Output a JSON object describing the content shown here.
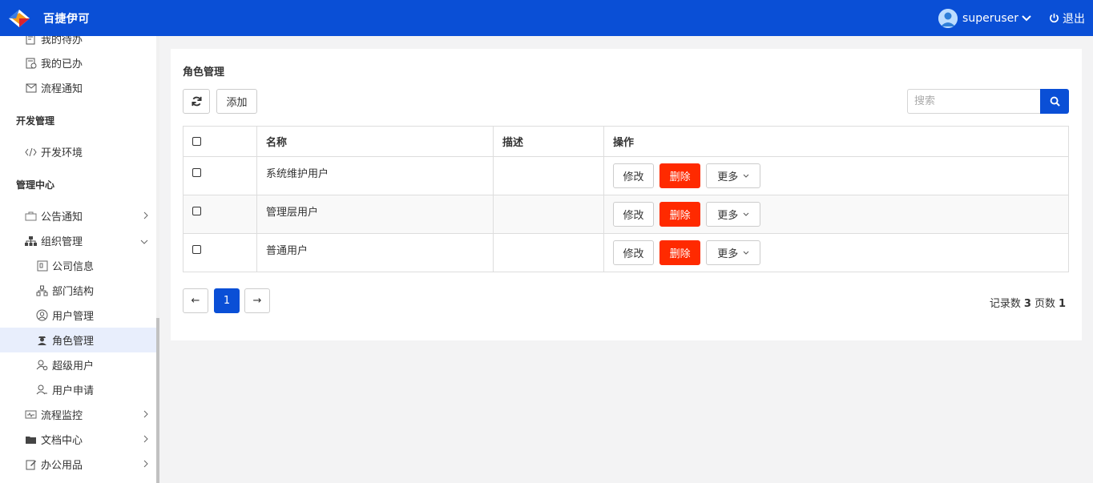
{
  "header": {
    "brand": "百捷伊可",
    "username": "superuser",
    "logout_label": "退出"
  },
  "sidebar": {
    "items_top": [
      {
        "label": "我的待办",
        "icon": "todo-list-icon"
      },
      {
        "label": "我的已办",
        "icon": "done-list-icon"
      },
      {
        "label": "流程通知",
        "icon": "mail-icon"
      }
    ],
    "section_dev": "开发管理",
    "dev_env": {
      "label": "开发环境",
      "icon": "code-icon"
    },
    "section_admin": "管理中心",
    "notice": {
      "label": "公告通知",
      "icon": "briefcase-icon"
    },
    "org": {
      "label": "组织管理",
      "icon": "org-tree-icon"
    },
    "org_children": [
      {
        "label": "公司信息",
        "icon": "company-icon"
      },
      {
        "label": "部门结构",
        "icon": "department-icon"
      },
      {
        "label": "用户管理",
        "icon": "user-circle-icon"
      },
      {
        "label": "角色管理",
        "icon": "role-icon"
      },
      {
        "label": "超级用户",
        "icon": "super-user-icon"
      },
      {
        "label": "用户申请",
        "icon": "user-apply-icon"
      }
    ],
    "flow_monitor": {
      "label": "流程监控",
      "icon": "monitor-icon"
    },
    "docs": {
      "label": "文档中心",
      "icon": "folder-icon"
    },
    "office": {
      "label": "办公用品",
      "icon": "edit-icon"
    }
  },
  "main": {
    "title": "角色管理",
    "add_label": "添加",
    "search_placeholder": "搜索",
    "table": {
      "headers": [
        "名称",
        "描述",
        "操作"
      ],
      "rows": [
        {
          "name": "系统维护用户",
          "desc": ""
        },
        {
          "name": "管理层用户",
          "desc": ""
        },
        {
          "name": "普通用户",
          "desc": ""
        }
      ],
      "edit_label": "修改",
      "delete_label": "删除",
      "more_label": "更多"
    },
    "pagination": {
      "prev": "←",
      "current": "1",
      "next": "→",
      "records_label": "记录数",
      "records_count": "3",
      "pages_label": "页数",
      "pages_count": "1"
    }
  },
  "colors": {
    "primary": "#0a4fd6",
    "danger": "#ff2a00",
    "active_bg": "#e8eefc"
  }
}
